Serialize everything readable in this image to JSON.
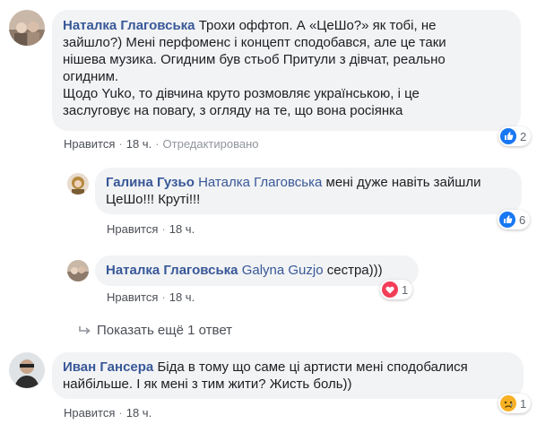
{
  "comments": [
    {
      "author": "Наталка Глаговська",
      "text_lines": [
        "Трохи оффтоп. А «ЦеШо?» як тобі, не",
        "зайшло?) Мені перфоменс і концепт сподобався, але це таки",
        "нішева музика. Огидним був стьоб Притули з дівчат, реально",
        "огидним.",
        "Щодо Yuko, то дівчина круто розмовляє українською, і це",
        "заслуговує на повагу, з огляду на те, що вона росіянка"
      ],
      "like_label": "Нравится",
      "time": "18 ч.",
      "edited": "Отредактировано",
      "reaction_count": "2",
      "reaction_icon": "like-icon"
    },
    {
      "author": "Галина Гузьо",
      "mention": "Наталка Глаговська",
      "text_first": "мені дуже навіть зайшли",
      "text_second": "ЦеШо!!! Круті!!!",
      "like_label": "Нравится",
      "time": "18 ч.",
      "reaction_count": "6",
      "reaction_icon": "like-icon"
    },
    {
      "author": "Наталка Глаговська",
      "mention": "Galyna Guzjo",
      "text": "сестра)))",
      "like_label": "Нравится",
      "time": "18 ч.",
      "reaction_count": "1",
      "reaction_icon": "love-icon"
    },
    {
      "author": "Иван Гансера",
      "text_first": "Біда в тому що саме ці артисти мені сподобалися",
      "text_second": "найбільше. І як мені з тим жити? Жисть боль))",
      "like_label": "Нравится",
      "time": "18 ч.",
      "reaction_count": "1",
      "reaction_icon": "sad-icon"
    }
  ],
  "show_more_replies": "Показать ещё 1 ответ",
  "separator": "·",
  "colors": {
    "link": "#385898",
    "bubble": "#f2f3f5",
    "meta": "#90949c",
    "like_blue": "#1877f2",
    "love_red": "#f33e58",
    "sad_yellow": "#f7b125"
  }
}
